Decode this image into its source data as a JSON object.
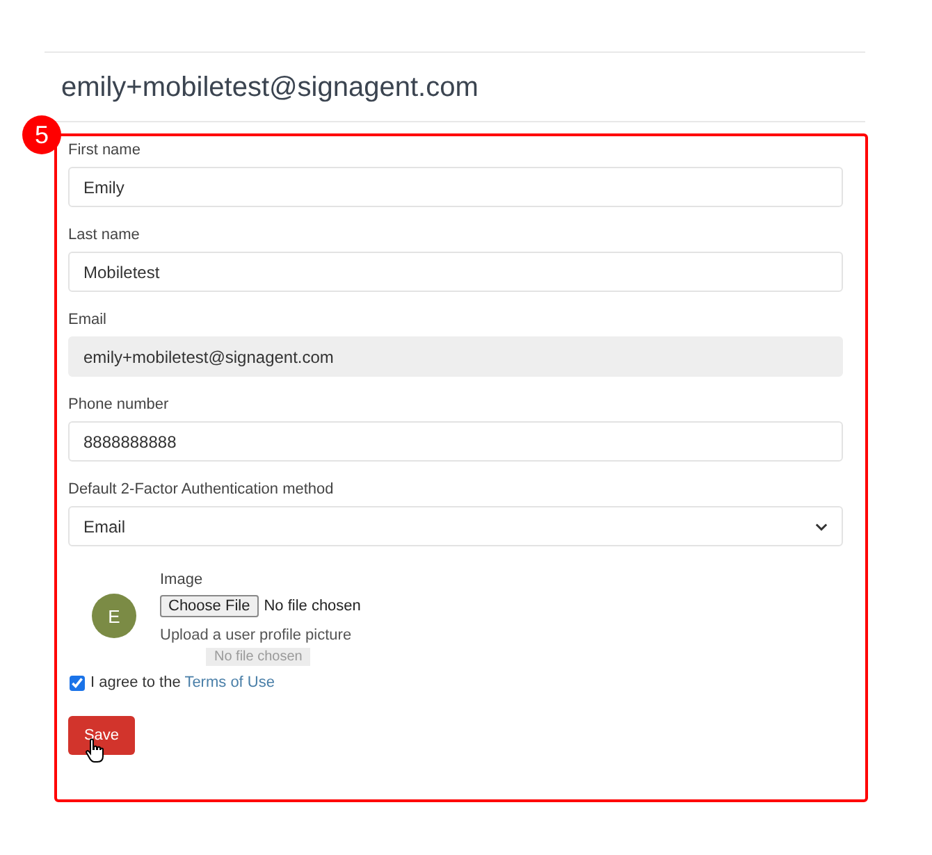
{
  "page_title": "emily+mobiletest@signagent.com",
  "step_badge": "5",
  "fields": [
    {
      "kind": "text",
      "label": "First name",
      "value": "Emily",
      "disabled": false
    },
    {
      "kind": "text",
      "label": "Last name",
      "value": "Mobiletest",
      "disabled": false
    },
    {
      "kind": "text",
      "label": "Email",
      "value": "emily+mobiletest@signagent.com",
      "disabled": true
    },
    {
      "kind": "text",
      "label": "Phone number",
      "value": "8888888888",
      "disabled": false
    },
    {
      "kind": "select",
      "label": "Default 2-Factor Authentication method",
      "value": "Email",
      "disabled": false
    }
  ],
  "image": {
    "label": "Image",
    "avatar_initial": "E",
    "file_button": "Choose File",
    "file_status": "No file chosen",
    "hint": "Upload a user profile picture",
    "drag_ghost": "No file chosen"
  },
  "terms": {
    "checked": true,
    "text": "I agree to the ",
    "link": "Terms of Use"
  },
  "save_button": "Save"
}
